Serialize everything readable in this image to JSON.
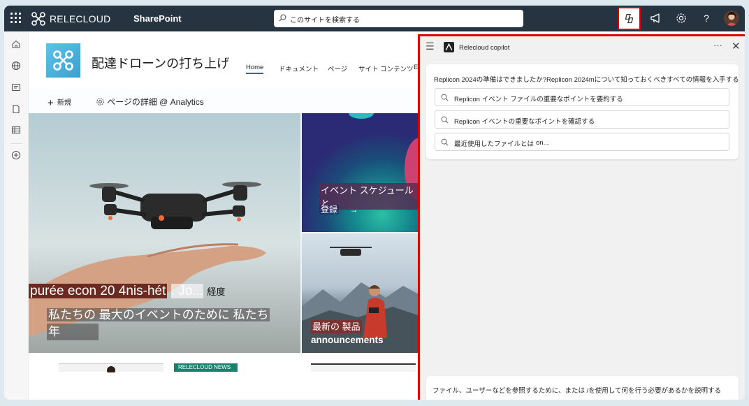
{
  "suite_bar": {
    "brand": "RELECLOUD",
    "app": "SharePoint",
    "search_placeholder": "このサイトを検索する",
    "icons": [
      "waffle-icon",
      "relecloud-logo",
      "search-icon",
      "copilot-icon",
      "megaphone-icon",
      "gear-icon",
      "help-icon",
      "avatar"
    ]
  },
  "left_rail": {
    "icons": [
      "home-icon",
      "globe-icon",
      "news-icon",
      "file-icon",
      "list-icon",
      "add-icon"
    ]
  },
  "site": {
    "title": "配達ドローンの打ち上げ",
    "nav": [
      "Home",
      "ドキュメント",
      "ページ",
      "サイト コンテンツ",
      "Ec"
    ]
  },
  "command_bar": {
    "new_label": "新規",
    "details_label": "ページの詳細 @ Analytics"
  },
  "hero": {
    "main_line1a": "purée econ 20 4nis-hét",
    "main_line1b": ". Jo...",
    "main_line1c": "経度",
    "main_line2": "私たちの 最大のイベントのために 私たち",
    "main_line3": "年",
    "event_title": "イベント スケジュールと",
    "event_link": "登録",
    "product_line1": "最新の 製品",
    "product_line2": "announcements"
  },
  "news": {
    "badge": "RELECLOUD NEWS"
  },
  "copilot": {
    "title": "Relecloud copilot",
    "prompt": "Replicon 2024の準備はできましたか?Replicon 2024mについて知っておくべきすべての情報を入手する",
    "suggestions": [
      "Replicon イベント ファイルの重要なポイントを要約する",
      "Replicon イベントの重要なポイントを確認する",
      "最近使用したファイルとは"
    ],
    "suggestion3_tail": "on...",
    "input_placeholder": "ファイル、ユーザーなどを参照するために、または /を使用して何を行う必要があるかを説明する",
    "accent": "#e10000"
  }
}
